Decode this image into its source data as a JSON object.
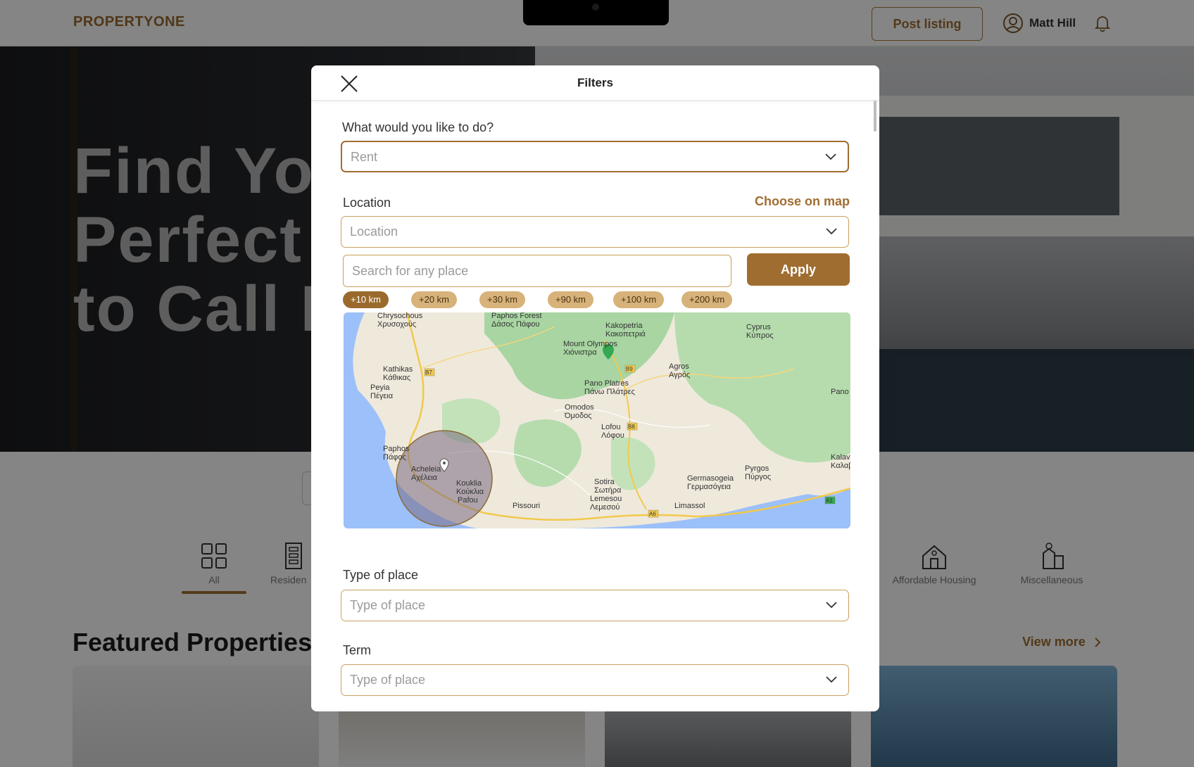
{
  "app": {
    "logo": "PROPERTYONE",
    "post_listing": "Post listing",
    "user_name": "Matt Hill"
  },
  "hero": {
    "title_lines": [
      "Find Your",
      "Perfect P",
      "to Call Ho"
    ]
  },
  "categories": [
    {
      "label": "All",
      "icon": "grid-icon"
    },
    {
      "label": "Residen",
      "icon": "apartment-icon"
    },
    {
      "label": "Affordable Housing",
      "icon": "house-icon"
    },
    {
      "label": "Miscellaneous",
      "icon": "buildings-icon"
    }
  ],
  "featured": {
    "title": "Featured Properties",
    "view_more": "View more"
  },
  "modal": {
    "title": "Filters",
    "action": {
      "label": "What would you like to do?",
      "value": "Rent"
    },
    "location": {
      "label": "Location",
      "choose_on_map": "Choose on map",
      "placeholder": "Location"
    },
    "search": {
      "placeholder": "Search for any place",
      "apply": "Apply"
    },
    "radius_chips": [
      "+10 km",
      "+20 km",
      "+30 km",
      "+90 km",
      "+100 km",
      "+200 km"
    ],
    "selected_radius": "+10 km",
    "map": {
      "labels": [
        {
          "text": "Kakopetria",
          "sub": "Κακοπετριά"
        },
        {
          "text": "Mount Olympos",
          "sub": "Χιόνιστρα"
        },
        {
          "text": "Cyprus",
          "sub": "Κύπρος"
        },
        {
          "text": "Kathikas",
          "sub": "Κάθικας"
        },
        {
          "text": "Peyia",
          "sub": "Πέγεια"
        },
        {
          "text": "Agros",
          "sub": "Αγρός"
        },
        {
          "text": "Pano Platres",
          "sub": "Πάνω Πλάτρες"
        },
        {
          "text": "Omodos",
          "sub": "Όμοδος"
        },
        {
          "text": "Lofou",
          "sub": "Λόφου"
        },
        {
          "text": "Paphos",
          "sub": "Πάφος"
        },
        {
          "text": "Acheleia",
          "sub": "Αχέλεια"
        },
        {
          "text": "Kouklia",
          "sub": "Κούκλια"
        },
        {
          "text": "Pafou",
          "sub": ""
        },
        {
          "text": "Sotira",
          "sub": "Σωτήρα"
        },
        {
          "text": "Lemesou",
          "sub": "Λεμεσού"
        },
        {
          "text": "Germasogeia",
          "sub": "Γερμασόγεια"
        },
        {
          "text": "Pyrgos",
          "sub": "Πύργος"
        },
        {
          "text": "Pissouri",
          "sub": ""
        },
        {
          "text": "Limassol",
          "sub": ""
        },
        {
          "text": "Chrysochous",
          "sub": "Χρυσοχούς"
        },
        {
          "text": "Paphos Forest",
          "sub": "Δάσος Πάφου"
        },
        {
          "text": "Pano",
          "sub": ""
        },
        {
          "text": "Kalav",
          "sub": "Καλαβ"
        }
      ],
      "roads": [
        "B7",
        "B9",
        "B8",
        "A6",
        "A1"
      ]
    },
    "type_of_place": {
      "label": "Type of place",
      "placeholder": "Type of place"
    },
    "term": {
      "label": "Term",
      "placeholder": "Type of place"
    }
  },
  "colors": {
    "accent": "#a06d30",
    "chip": "#d7b27a",
    "border": "#c9a05e"
  }
}
